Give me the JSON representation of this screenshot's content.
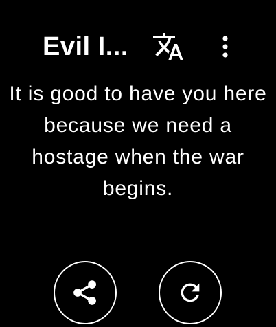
{
  "header": {
    "title": "Evil I...",
    "translate_icon": "translate-icon",
    "menu_icon": "more-vert-icon"
  },
  "quote": {
    "text": "It is good to have you here because we need a hostage when the war begins."
  },
  "actions": {
    "share_icon": "share-icon",
    "refresh_icon": "refresh-icon"
  },
  "colors": {
    "background": "#000000",
    "foreground": "#ffffff"
  }
}
